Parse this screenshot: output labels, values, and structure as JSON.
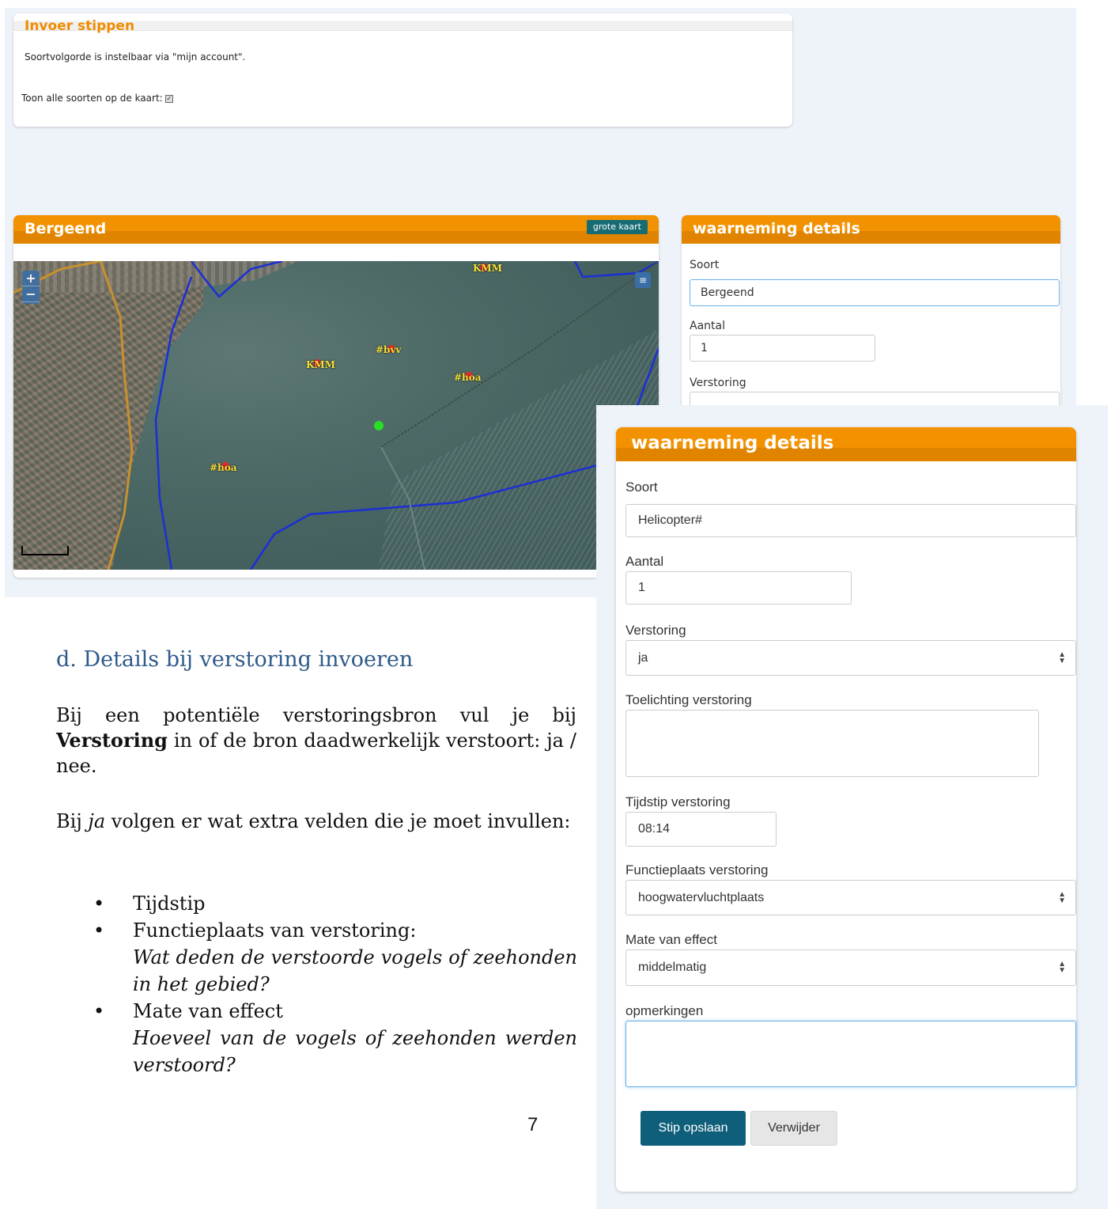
{
  "stippen_panel": {
    "title": "Invoer stippen",
    "note": "Soortvolgorde is instelbaar via \"mijn account\".",
    "toggle_label": "Toon alle soorten op de kaart:",
    "toggle_checked": true
  },
  "map_panel": {
    "title": "Bergeend",
    "big_map_button": "grote kaart",
    "zoom_in": "+",
    "zoom_out": "−",
    "markers": [
      {
        "label": "KMM"
      },
      {
        "label": "#bvv"
      },
      {
        "label": "KMM"
      },
      {
        "label": "#hoa"
      },
      {
        "label": "#hoa"
      }
    ]
  },
  "small_details": {
    "title": "waarneming details",
    "soort_label": "Soort",
    "soort_value": "Bergeend",
    "aantal_label": "Aantal",
    "aantal_value": "1",
    "verstoring_label": "Verstoring"
  },
  "doc": {
    "heading": "d. Details bij verstoring invoeren",
    "p1_before": "Bij een potentiële verstoringsbron vul je bij ",
    "p1_bold": "Verstoring",
    "p1_after": " in of de bron daadwerkelijk verstoort: ja / nee.",
    "p2_before": "Bij ",
    "p2_italic": "ja",
    "p2_after": " volgen er wat extra velden die je moet invullen:",
    "bullets": [
      {
        "main": "Tijdstip",
        "sub": ""
      },
      {
        "main": "Functieplaats van verstoring:",
        "sub": "Wat deden de verstoorde vogels of zeehonden  in het gebied?"
      },
      {
        "main": "Mate van effect",
        "sub": "Hoeveel van de vogels of zeehonden werden verstoord?"
      }
    ],
    "page_number": "7"
  },
  "details_form": {
    "title": "waarneming details",
    "soort_label": "Soort",
    "soort_value": "Helicopter#",
    "aantal_label": "Aantal",
    "aantal_value": "1",
    "verstoring_label": "Verstoring",
    "verstoring_value": "ja",
    "toelichting_label": "Toelichting verstoring",
    "toelichting_value": "",
    "tijdstip_label": "Tijdstip verstoring",
    "tijdstip_value": "08:14",
    "functieplaats_label": "Functieplaats verstoring",
    "functieplaats_value": "hoogwatervluchtplaats",
    "effect_label": "Mate van effect",
    "effect_value": "middelmatig",
    "opmerkingen_label": "opmerkingen",
    "opmerkingen_value": "",
    "save_button": "Stip opslaan",
    "delete_button": "Verwijder"
  },
  "colors": {
    "header_orange": "#f39200",
    "primary_button": "#0f5f7a",
    "heading_blue": "#2e5a8a",
    "grote_kaart_bg": "#176c73"
  }
}
